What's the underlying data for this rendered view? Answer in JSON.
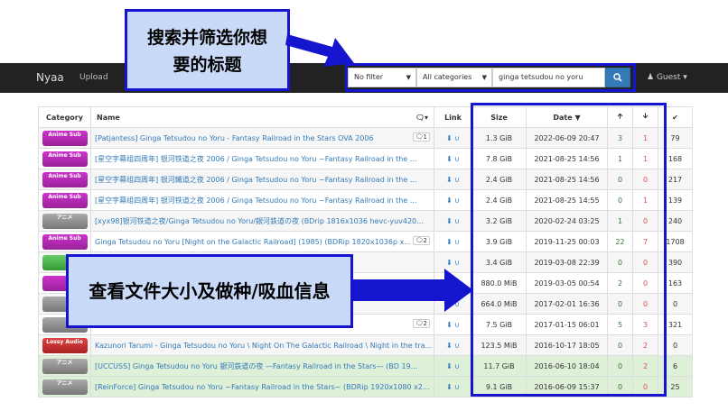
{
  "navbar": {
    "brand": "Nyaa",
    "upload": "Upload",
    "filter_value": "No filter",
    "category_value": "All categories",
    "search_value": "ginga tetsudou no yoru",
    "guest": "Guest"
  },
  "table": {
    "headers": {
      "category": "Category",
      "name": "Name",
      "link": "Link",
      "size": "Size",
      "date": "Date"
    },
    "rows": [
      {
        "cat": "Anime Sub",
        "cat_type": "anime",
        "name": "[Patjantess] Ginga Tetsudou no Yoru - Fantasy Railroad in the Stars OVA 2006",
        "comments": "1",
        "size": "1.3 GiB",
        "date": "2022-06-09 20:47",
        "seed": "3",
        "leech": "1",
        "dl": "79"
      },
      {
        "cat": "Anime Sub",
        "cat_type": "anime",
        "name": "[星空字幕组四周年] 银河铁道之夜 2006 / Ginga Tetsudou no Yoru ~Fantasy Railroad in the ...",
        "comments": "",
        "size": "7.8 GiB",
        "date": "2021-08-25 14:56",
        "seed": "1",
        "leech": "1",
        "dl": "168"
      },
      {
        "cat": "Anime Sub",
        "cat_type": "anime",
        "name": "[星空字幕组四周年] 银河鐵道之夜 2006 / Ginga Tetsudou no Yoru ~Fantasy Railroad in the ...",
        "comments": "",
        "size": "2.4 GiB",
        "date": "2021-08-25 14:56",
        "seed": "0",
        "leech": "0",
        "dl": "217"
      },
      {
        "cat": "Anime Sub",
        "cat_type": "anime",
        "name": "[星空字幕组四周年] 银河铁道之夜 2006 / Ginga Tetsudou no Yoru ~Fantasy Railroad in the ...",
        "comments": "",
        "size": "2.4 GiB",
        "date": "2021-08-25 14:55",
        "seed": "0",
        "leech": "1",
        "dl": "139"
      },
      {
        "cat": "アニメ",
        "cat_type": "raw",
        "name": "[xyx98]银河铁道之夜/Ginga Tetsudou no Yoru/銀河鉄道の夜 (BDrip 1816x1036 hevc-yuv420...",
        "comments": "",
        "size": "3.2 GiB",
        "date": "2020-02-24 03:25",
        "seed": "1",
        "leech": "0",
        "dl": "240"
      },
      {
        "cat": "Anime Sub",
        "cat_type": "anime",
        "name": "Ginga Tetsudou no Yoru [Night on the Galactic Railroad] (1985) (BDRip 1820x1036p x...",
        "comments": "2",
        "size": "3.9 GiB",
        "date": "2019-11-25 00:03",
        "seed": "22",
        "leech": "7",
        "dl": "1708"
      },
      {
        "cat": "",
        "cat_type": "green",
        "name": "道の夜 ますむらひ...",
        "comments": "",
        "size": "3.4 GiB",
        "date": "2019-03-08 22:39",
        "seed": "0",
        "leech": "0",
        "dl": "390"
      },
      {
        "cat": "",
        "cat_type": "anime",
        "name": "",
        "comments": "",
        "size": "880.0 MiB",
        "date": "2019-03-05 00:54",
        "seed": "2",
        "leech": "0",
        "dl": "163"
      },
      {
        "cat": "",
        "cat_type": "raw",
        "name": "",
        "comments": "",
        "size": "664.0 MiB",
        "date": "2017-02-01 16:36",
        "seed": "0",
        "leech": "0",
        "dl": "0"
      },
      {
        "cat": "",
        "cat_type": "raw",
        "name": "鉄道の夜 -F...",
        "comments": "2",
        "size": "7.5 GiB",
        "date": "2017-01-15 06:01",
        "seed": "5",
        "leech": "3",
        "dl": "321"
      },
      {
        "cat": "Lossy Audio",
        "cat_type": "lossy",
        "name": "Kazunori Tarumi - Ginga Tetsudou no Yoru \\ Night On The Galactic Railroad \\ Night in the tra...",
        "comments": "",
        "size": "123.5 MiB",
        "date": "2016-10-17 18:05",
        "seed": "0",
        "leech": "2",
        "dl": "0"
      },
      {
        "cat": "アニメ",
        "cat_type": "raw",
        "name": "[UCCUSS] Ginga Tetsudou no Yoru 銀河鉄道の夜 —Fantasy Railroad in the Stars— (BD 19...",
        "comments": "",
        "size": "11.7 GiB",
        "date": "2016-06-10 18:04",
        "seed": "0",
        "leech": "2",
        "dl": "6",
        "success": true
      },
      {
        "cat": "アニメ",
        "cat_type": "raw",
        "name": "[ReinForce] Ginga Tetsudou no Yoru ~Fantasy Railroad in the Stars~ (BDRip 1920x1080 x2...",
        "comments": "",
        "size": "9.1 GiB",
        "date": "2016-06-09 15:37",
        "seed": "0",
        "leech": "0",
        "dl": "25",
        "success": true
      }
    ]
  },
  "annotations": {
    "top": "搜索并筛选你想要的标题",
    "middle": "查看文件大小及做种/吸血信息"
  },
  "colors": {
    "annotation_fill": "#c9daf8",
    "annotation_border": "#1515d0",
    "navbar": "#222222",
    "link": "#337ab7"
  }
}
